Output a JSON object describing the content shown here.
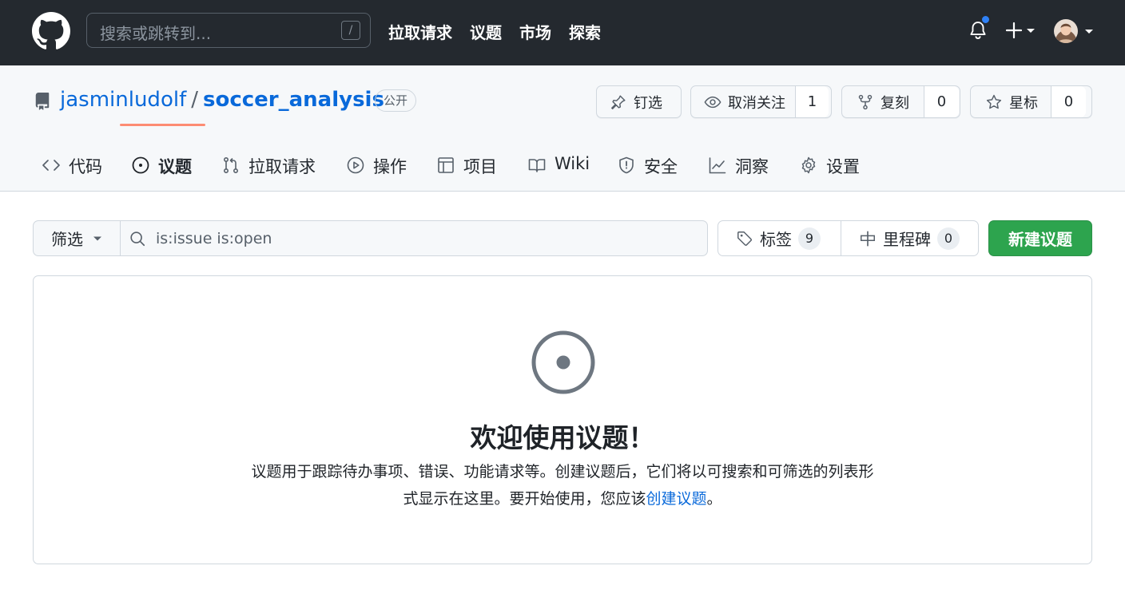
{
  "header": {
    "search_placeholder": "搜索或跳转到...",
    "search_shortcut": "/",
    "nav": [
      "拉取请求",
      "议题",
      "市场",
      "探索"
    ]
  },
  "repo": {
    "owner": "jasminludolf",
    "separator": "/",
    "name": "soccer_analysis",
    "visibility": "公开",
    "actions": {
      "pin_label": "钉选",
      "watch_label": "取消关注",
      "watch_count": "1",
      "fork_label": "复刻",
      "fork_count": "0",
      "star_label": "星标",
      "star_count": "0"
    },
    "tabs": [
      {
        "label": "代码",
        "icon": "code-icon"
      },
      {
        "label": "议题",
        "icon": "issue-opened-icon",
        "active": true
      },
      {
        "label": "拉取请求",
        "icon": "git-pull-request-icon"
      },
      {
        "label": "操作",
        "icon": "play-icon"
      },
      {
        "label": "项目",
        "icon": "table-icon"
      },
      {
        "label": "Wiki",
        "icon": "book-icon"
      },
      {
        "label": "安全",
        "icon": "shield-icon"
      },
      {
        "label": "洞察",
        "icon": "graph-icon"
      },
      {
        "label": "设置",
        "icon": "gear-icon"
      }
    ]
  },
  "issues": {
    "filter_label": "筛选",
    "search_value": "is:issue is:open",
    "labels_label": "标签",
    "labels_count": "9",
    "milestones_label": "里程碑",
    "milestones_count": "0",
    "new_issue_label": "新建议题"
  },
  "blankslate": {
    "title": "欢迎使用议题！",
    "desc_line1": "议题用于跟踪待办事项、错误、功能请求等。创建议题后，它们将以可搜索和可筛选的列表形",
    "desc_line2_before": "式显示在这里。要开始使用，您应该",
    "desc_link": "创建议题",
    "desc_line2_after": "。"
  },
  "colors": {
    "header_bg": "#24292f",
    "link": "#0969da",
    "primary_button": "#2da44e",
    "tab_underline": "#fd8c73",
    "notification_dot": "#2f81f7"
  }
}
